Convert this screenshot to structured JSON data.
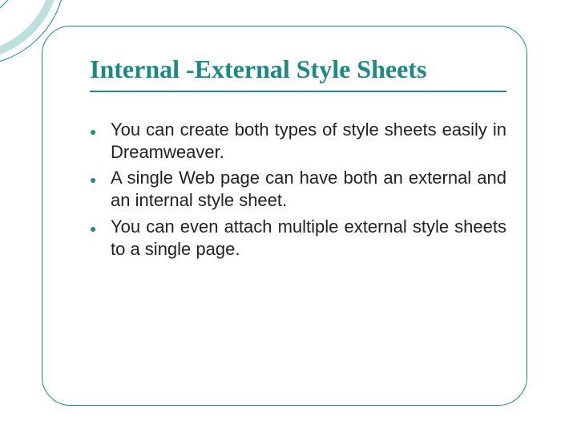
{
  "slide": {
    "title": "Internal -External Style Sheets",
    "bullets": [
      "You can create both types of style sheets easily in Dreamweaver.",
      "A single Web page can have both an external and an internal style sheet.",
      "You can even attach multiple external style sheets to a single page."
    ]
  },
  "theme": {
    "accent_color": "#1a8a82",
    "accent_light": "#bde0dd",
    "bullet_glyph": "●"
  }
}
